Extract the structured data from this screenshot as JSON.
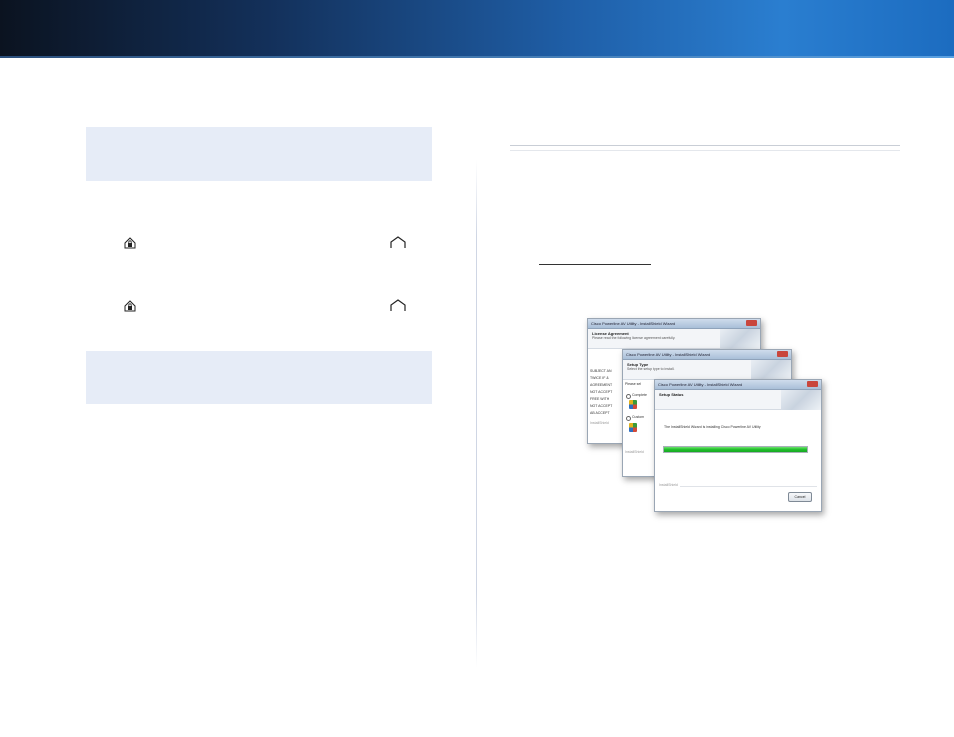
{
  "header": {
    "banner_color_dark": "#0b1320",
    "banner_color_light": "#2a7ed0"
  },
  "left_column": {
    "note_box_color": "#e6ecf7",
    "icons": [
      "home-lock-icon",
      "home-outline-icon",
      "home-lock-icon",
      "home-outline-icon"
    ]
  },
  "wizard_windows": [
    {
      "title": "Cisco Powerline AV Utility - InstallShield Wizard",
      "header_title": "License Agreement",
      "header_sub": "Please read the following license agreement carefully.",
      "body_lines": [
        "SUBJECT AN",
        "TWICE IF &",
        "AGREEMENT",
        "NOT ACCEPT",
        "FREE WITH",
        "NOT ACCEPT",
        "AB ACCEPT"
      ],
      "footer": "InstallShield"
    },
    {
      "title": "Cisco Powerline AV Utility - InstallShield Wizard",
      "header_title": "Setup Type",
      "header_sub": "Select the setup type to install.",
      "body_lines": [
        "Please sel",
        "Complete",
        "Custom"
      ],
      "footer": "InstallShield"
    },
    {
      "title": "Cisco Powerline AV Utility - InstallShield Wizard",
      "header_title": "Setup Status",
      "status_text": "The InstallShield Wizard is installing Cisco Powerline AV Utility",
      "progress": 1.0,
      "progress_color": "#1fbf2a",
      "footer": "InstallShield",
      "cancel_label": "Cancel"
    }
  ]
}
